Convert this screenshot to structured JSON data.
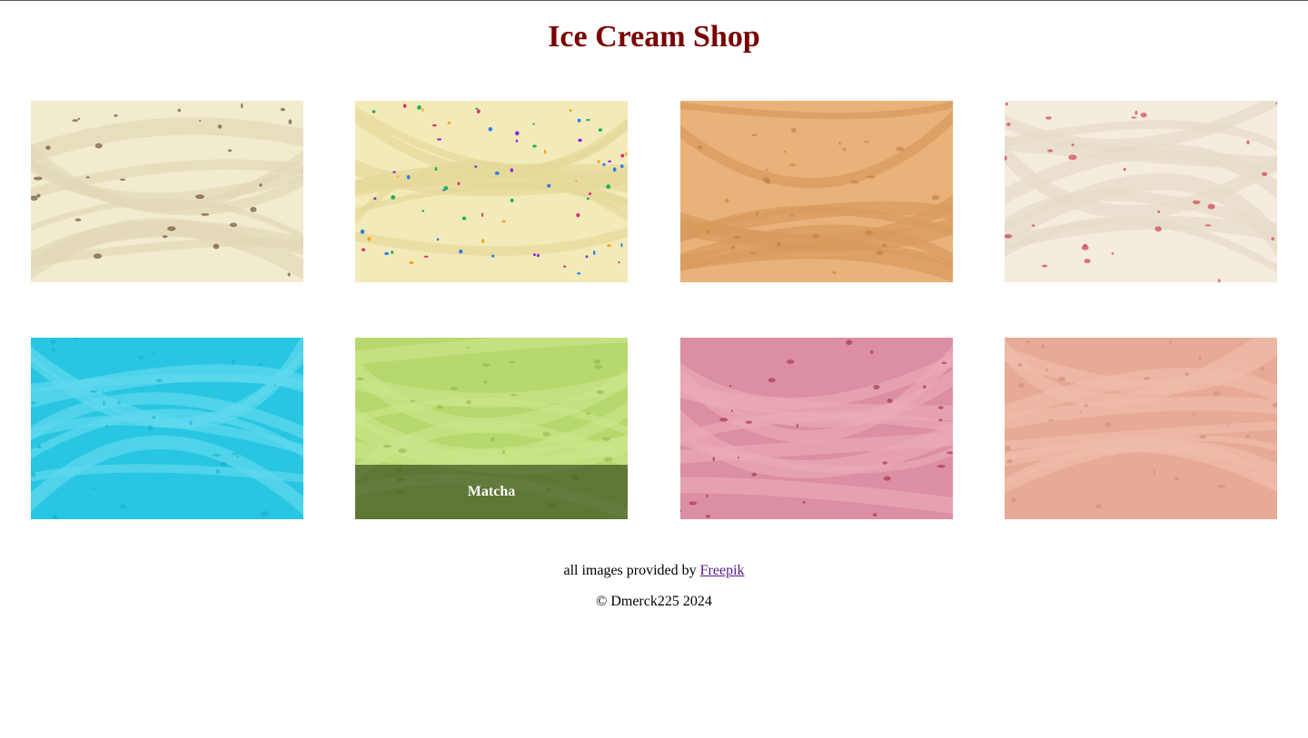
{
  "header": {
    "title": "Ice Cream Shop"
  },
  "gallery": {
    "flavors": [
      {
        "image": "chocolate-chip-ice-cream-texture",
        "colors": [
          "#f1ebcf",
          "#e2d9b6",
          "#4a2a18"
        ]
      },
      {
        "image": "birthday-cake-sprinkles-ice-cream-texture",
        "colors": [
          "#f3eab9",
          "#e6d89a",
          "#e0307a"
        ]
      },
      {
        "image": "peanut-butter-ice-cream-texture",
        "colors": [
          "#e9b27a",
          "#d89a5c",
          "#b97a40"
        ]
      },
      {
        "image": "strawberry-swirl-ice-cream-texture",
        "colors": [
          "#f4ecdf",
          "#e7dcc8",
          "#c4142c"
        ]
      },
      {
        "image": "blue-ice-cream-texture",
        "colors": [
          "#28c6e2",
          "#5fd9ee",
          "#14a9c8"
        ]
      },
      {
        "image": "matcha-ice-cream-texture",
        "colors": [
          "#b6d86c",
          "#cbe58a",
          "#8db444"
        ],
        "caption": "Matcha"
      },
      {
        "image": "berry-pink-ice-cream-texture",
        "colors": [
          "#dc8ea2",
          "#e9a9b8",
          "#9a1f3c"
        ]
      },
      {
        "image": "salmon-pink-ice-cream-texture",
        "colors": [
          "#e7aa96",
          "#efbcaa",
          "#c98a76"
        ]
      }
    ]
  },
  "footer": {
    "credit_text": "all images provided by",
    "credit_link": "Freepik",
    "copyright": "© Dmerck225 2024"
  }
}
